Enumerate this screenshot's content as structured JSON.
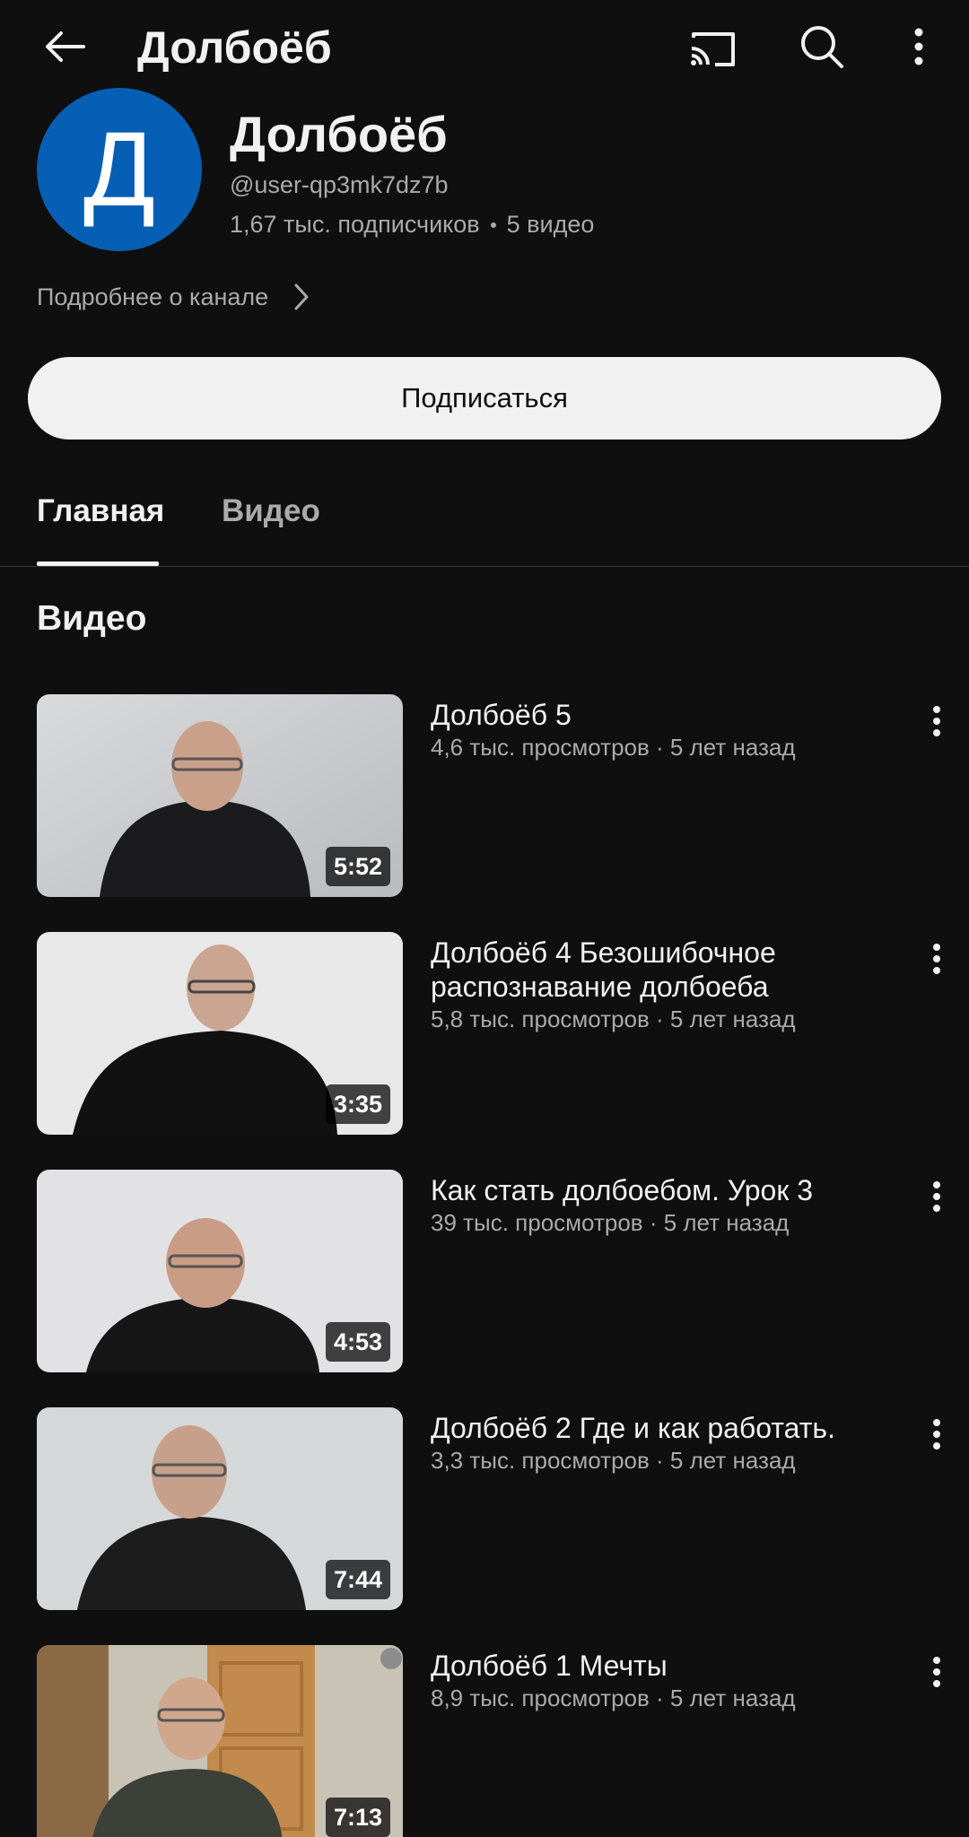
{
  "topbar": {
    "title": "Долбоёб",
    "icons": [
      "back-arrow-icon",
      "cast-icon",
      "search-icon",
      "more-vert-icon"
    ]
  },
  "channel": {
    "avatar_letter": "Д",
    "avatar_color": "#065fb4",
    "name": "Долбоёб",
    "handle": "@user-qp3mk7dz7b",
    "subscribers": "1,67 тыс. подписчиков",
    "video_count": "5 видео",
    "about_label": "Подробнее о канале"
  },
  "subscribe_label": "Подписаться",
  "tabs": [
    {
      "label": "Главная",
      "active": true
    },
    {
      "label": "Видео",
      "active": false
    }
  ],
  "section_title": "Видео",
  "videos": [
    {
      "title": "Долбоёб 5",
      "meta": "4,6 тыс. просмотров · 5 лет назад",
      "duration": "5:52"
    },
    {
      "title": "Долбоёб 4 Безошибочное распознавание долбоеба",
      "meta": "5,8 тыс. просмотров · 5 лет назад",
      "duration": "3:35"
    },
    {
      "title": "Как стать долбоебом. Урок 3",
      "meta": "39 тыс. просмотров · 5 лет назад",
      "duration": "4:53"
    },
    {
      "title": "Долбоёб 2 Где и как работать.",
      "meta": "3,3 тыс. просмотров · 5 лет назад",
      "duration": "7:44"
    },
    {
      "title": "Долбоёб 1 Мечты",
      "meta": "8,9 тыс. просмотров · 5 лет назад",
      "duration": "7:13"
    }
  ],
  "colors": {
    "background": "#0f0f0f",
    "text_primary": "#f1f1f1",
    "text_secondary": "#aaaaaa",
    "subscribe_bg": "#f1f1f1"
  }
}
